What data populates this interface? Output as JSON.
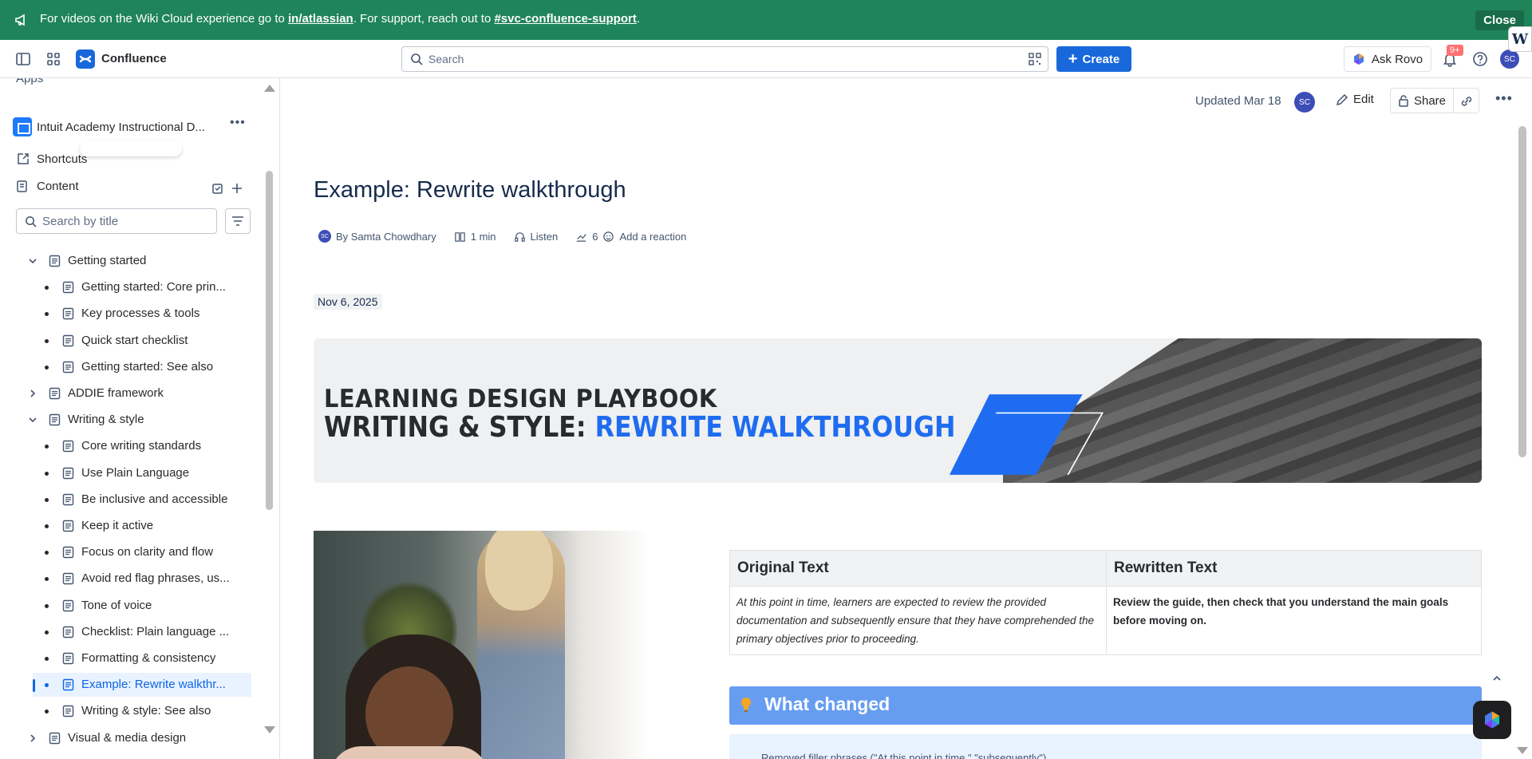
{
  "banner": {
    "prefix": "For videos on the Wiki Cloud experience go to ",
    "link1": "in/atlassian",
    "middle": ". For support, reach out to ",
    "link2": "#svc-confluence-support",
    "suffix": ".",
    "close_label": "Close"
  },
  "topnav": {
    "product": "Confluence",
    "search_placeholder": "Search",
    "create_label": "Create",
    "ask_rovo_label": "Ask Rovo",
    "notifications_badge": "9+",
    "avatar_initials": "SC"
  },
  "sidebar": {
    "apps_label": "Apps",
    "space_name": "Intuit Academy Instructional D...",
    "shortcuts_label": "Shortcuts",
    "content_label": "Content",
    "search_placeholder": "Search by title",
    "tree": [
      {
        "label": "Getting started",
        "level": 0,
        "expanded": true
      },
      {
        "label": "Getting started: Core prin...",
        "level": 1
      },
      {
        "label": "Key processes & tools",
        "level": 1
      },
      {
        "label": "Quick start checklist",
        "level": 1
      },
      {
        "label": "Getting started: See also",
        "level": 1
      },
      {
        "label": "ADDIE framework",
        "level": 0,
        "expanded": false
      },
      {
        "label": "Writing & style",
        "level": 0,
        "expanded": true
      },
      {
        "label": "Core writing standards",
        "level": 1
      },
      {
        "label": "Use Plain Language",
        "level": 1
      },
      {
        "label": "Be inclusive and accessible",
        "level": 1
      },
      {
        "label": "Keep it active",
        "level": 1
      },
      {
        "label": "Focus on clarity and flow",
        "level": 1
      },
      {
        "label": "Avoid red flag phrases, us...",
        "level": 1
      },
      {
        "label": "Tone of voice",
        "level": 1
      },
      {
        "label": "Checklist: Plain language ...",
        "level": 1
      },
      {
        "label": "Formatting & consistency",
        "level": 1
      },
      {
        "label": "Example: Rewrite walkthr...",
        "level": 1,
        "active": true
      },
      {
        "label": "Writing & style: See also",
        "level": 1
      },
      {
        "label": "Visual & media design",
        "level": 0,
        "expanded": false
      }
    ]
  },
  "pagebar": {
    "updated": "Updated Mar 18",
    "avatar_initials": "SC",
    "edit_label": "Edit",
    "share_label": "Share"
  },
  "page": {
    "title": "Example: Rewrite walkthrough",
    "author": "By Samta Chowdhary",
    "author_initials": "SC",
    "read_time": "1 min",
    "listen_label": "Listen",
    "views": "6",
    "reaction_label": "Add a reaction",
    "date": "Nov 6, 2025",
    "hero_line1": "LEARNING DESIGN PLAYBOOK",
    "hero_line2_a": "WRITING & STYLE: ",
    "hero_line2_b": "REWRITE WALKTHROUGH",
    "table": {
      "headers": [
        "Original Text",
        "Rewritten Text"
      ],
      "original": "At this point in time, learners are expected to review the provided documentation and subsequently ensure that they have comprehended the primary objectives prior to proceeding.",
      "rewritten": "Review the guide, then check that you understand the main goals before moving on."
    },
    "panel_title": "What changed",
    "panel_text": "Removed filler phrases (\"At this point in time,\" \"subsequently\")."
  },
  "colors": {
    "banner": "#1f845a",
    "accent": "#1868db",
    "hero_blue": "#1f6cf0",
    "panel": "#669df1"
  }
}
